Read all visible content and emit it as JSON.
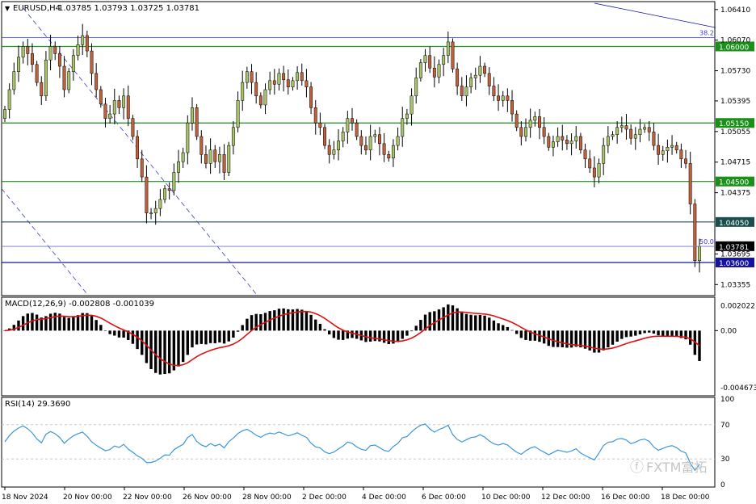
{
  "header": {
    "symbol": "EURUSD,H4",
    "quote": "1.03785 1.03793 1.03725 1.03781"
  },
  "watermark": "FXTM富拓",
  "colors": {
    "bull": "#a8c36a",
    "bear": "#c0613b",
    "wick": "#000000",
    "green_level": "#1a8f1a",
    "blue_level": "#1414a0",
    "dark_level": "#1a4d4d",
    "fib_blue": "#3a3acd",
    "macd_bar": "#000000",
    "macd_signal": "#e01010",
    "rsi_line": "#3c96dc",
    "current_price_bg": "#000000"
  },
  "chart_data": [
    {
      "type": "candlestick",
      "name": "EURUSD,H4",
      "ylim": [
        1.0325,
        1.0648
      ],
      "x_tick_labels": [
        "18 Nov 2024",
        "20 Nov 00:00",
        "22 Nov 00:00",
        "26 Nov 00:00",
        "28 Nov 00:00",
        "2 Dec 00:00",
        "4 Dec 00:00",
        "6 Dec 00:00",
        "10 Dec 00:00",
        "12 Dec 00:00",
        "16 Dec 00:00",
        "18 Dec 00:00"
      ],
      "y_tick_labels": [
        "1.06410",
        "1.06070",
        "1.05730",
        "1.05395",
        "1.05055",
        "1.04715",
        "1.04375",
        "1.03695",
        "1.03355"
      ],
      "horizontal_levels": [
        {
          "label": "1.06000",
          "price": 1.06,
          "style": "green"
        },
        {
          "label": "1.05150",
          "price": 1.0515,
          "style": "green"
        },
        {
          "label": "1.04500",
          "price": 1.045,
          "style": "green"
        },
        {
          "label": "1.04050",
          "price": 1.0405,
          "style": "dark"
        },
        {
          "label": "1.03600",
          "price": 1.036,
          "style": "blue"
        }
      ],
      "fib_levels": [
        {
          "label": "38.2",
          "price": 1.061
        },
        {
          "label": "50.0",
          "price": 1.0378
        }
      ],
      "current_price": "1.03781",
      "closes": [
        1.053,
        1.0552,
        1.0572,
        1.0588,
        1.06,
        1.0592,
        1.058,
        1.056,
        1.0545,
        1.0585,
        1.06,
        1.0592,
        1.0578,
        1.0552,
        1.0572,
        1.059,
        1.0602,
        1.0612,
        1.0595,
        1.057,
        1.0552,
        1.0536,
        1.052,
        1.0525,
        1.054,
        1.0532,
        1.0545,
        1.052,
        1.05,
        1.0475,
        1.0455,
        1.0415,
        1.0415,
        1.042,
        1.043,
        1.0442,
        1.044,
        1.046,
        1.0472,
        1.0482,
        1.0515,
        1.0532,
        1.05,
        1.048,
        1.047,
        1.0485,
        1.0472,
        1.048,
        1.046,
        1.049,
        1.051,
        1.054,
        1.056,
        1.0572,
        1.056,
        1.0545,
        1.0535,
        1.0552,
        1.0562,
        1.0558,
        1.057,
        1.0563,
        1.0555,
        1.0562,
        1.0571,
        1.0562,
        1.0555,
        1.0532,
        1.0515,
        1.051,
        1.049,
        1.048,
        1.0485,
        1.0495,
        1.0505,
        1.052,
        1.0515,
        1.05,
        1.049,
        1.0485,
        1.05,
        1.0502,
        1.0492,
        1.048,
        1.0476,
        1.049,
        1.05,
        1.052,
        1.0525,
        1.0545,
        1.0565,
        1.0582,
        1.059,
        1.0576,
        1.0566,
        1.058,
        1.059,
        1.0605,
        1.0575,
        1.0556,
        1.0545,
        1.0555,
        1.0565,
        1.0568,
        1.0578,
        1.057,
        1.0556,
        1.0545,
        1.054,
        1.0545,
        1.054,
        1.0525,
        1.051,
        1.05,
        1.051,
        1.0518,
        1.0522,
        1.051,
        1.05,
        1.0488,
        1.0494,
        1.05,
        1.0496,
        1.0492,
        1.0495,
        1.05,
        1.0485,
        1.0475,
        1.0465,
        1.0455,
        1.047,
        1.049,
        1.05,
        1.0502,
        1.051,
        1.0512,
        1.0508,
        1.0498,
        1.0502,
        1.0508,
        1.051,
        1.0505,
        1.049,
        1.048,
        1.0484,
        1.0488,
        1.049,
        1.0485,
        1.0475,
        1.047,
        1.0425,
        1.0362,
        1.0378
      ]
    },
    {
      "type": "bar",
      "name": "MACD(12,26,9)",
      "title": "MACD(12,26,9) -0.002808 -0.001039",
      "ylim": [
        -0.0052,
        0.0026
      ],
      "y_tick_labels": [
        "0.002022",
        "0.00",
        "-0.004673"
      ]
    },
    {
      "type": "line",
      "name": "RSI(14)",
      "title": "RSI(14) 29.3690",
      "ylim": [
        0,
        100
      ],
      "y_tick_labels": [
        "100",
        "70",
        "30",
        "0"
      ],
      "levels": [
        70,
        30
      ]
    }
  ]
}
